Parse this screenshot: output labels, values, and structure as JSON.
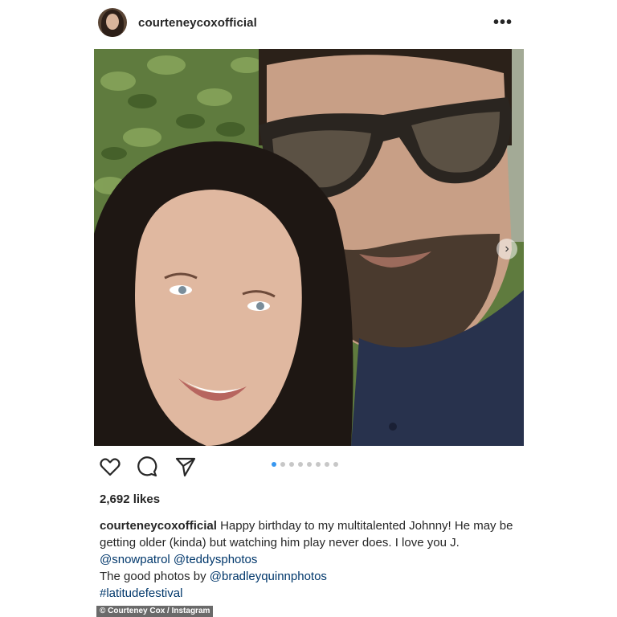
{
  "post": {
    "username": "courteneycoxofficial",
    "more_icon": "more-horizontal-icon",
    "photo_icon": "next-photo-arrow-icon",
    "carousel": {
      "total": 8,
      "active_index": 0
    },
    "likes": "2,692 likes",
    "caption": {
      "username": "courteneycoxofficial",
      "text": "Happy birthday to my multitalented Johnny! He may be getting older (kinda) but watching him play never does. I love you J.",
      "mentions": "@snowpatrol @teddysphotos",
      "credit_prefix": "The good photos by ",
      "credit_handle": "@bradleyquinnphotos",
      "hashtag": "#latitudefestival"
    },
    "actions": {
      "like_icon": "heart-icon",
      "comment_icon": "comment-icon",
      "share_icon": "send-icon"
    }
  },
  "watermark": "© Courteney Cox / Instagram",
  "colors": {
    "link": "#00376b",
    "active_dot": "#3897f0",
    "inactive_dot": "#c7c7c7"
  }
}
